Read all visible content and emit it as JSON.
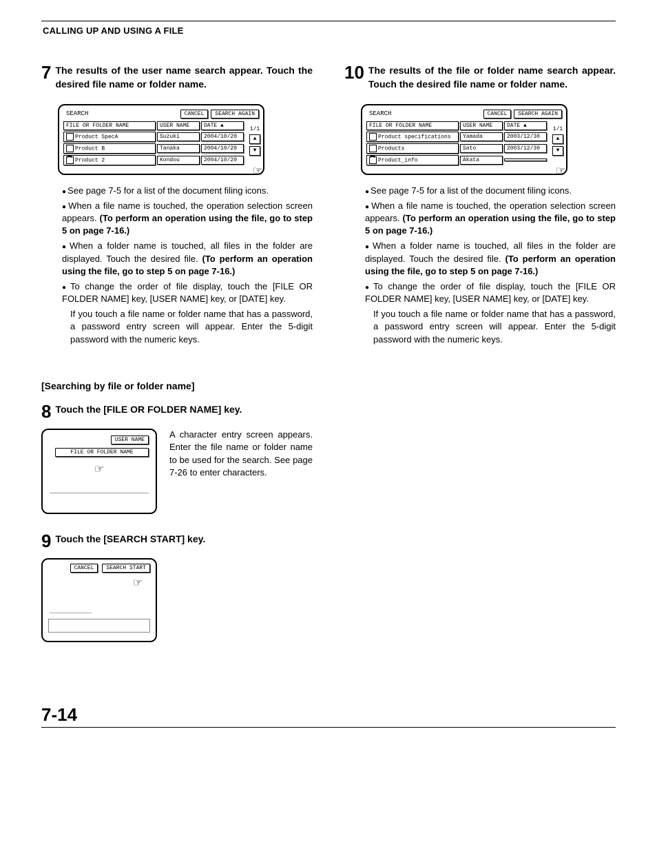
{
  "header": "CALLING UP AND USING A FILE",
  "page_number": "7-14",
  "left": {
    "step7": {
      "num": "7",
      "text": "The results of the user name search appear. Touch the desired file name or folder name.",
      "screen": {
        "title": "SEARCH",
        "cancel": "CANCEL",
        "search_again": "SEARCH AGAIN",
        "col_file": "FILE OR FOLDER NAME",
        "col_user": "USER NAME",
        "col_date": "DATE",
        "page_indicator": "1/1",
        "rows": [
          {
            "file": "Product SpecA",
            "user": "Suzuki",
            "date": "2004/10/20"
          },
          {
            "file": "Product B",
            "user": "Tanaka",
            "date": "2004/10/20"
          },
          {
            "file": "Product 2",
            "user": "Kondou",
            "date": "2004/10/20"
          }
        ]
      },
      "bullets": {
        "b1": "See page 7-5 for a list of the document filing icons.",
        "b2a": "When a file name is touched, the operation selection screen appears. ",
        "b2b": "(To perform an operation using the file, go to step 5 on page 7-16.)",
        "b3a": "When a folder name is touched, all files in the folder are displayed. Touch the desired file. ",
        "b3b": "(To perform an operation using the file, go to step 5 on page 7-16.)",
        "b4": "To change the order of file display, touch the [FILE OR FOLDER NAME] key, [USER NAME] key, or [DATE] key.",
        "b4c": "If you touch a file name or folder name that has a password, a password entry screen will appear. Enter the 5-digit password with the numeric keys."
      }
    },
    "subheading": "[Searching by file or folder name]",
    "step8": {
      "num": "8",
      "text": "Touch the [FILE OR FOLDER NAME] key.",
      "screen": {
        "user_name": "USER NAME",
        "file_folder": "FILE OR FOLDER NAME"
      },
      "desc": "A character entry screen appears. Enter the file name or folder name to be used for the search. See page 7-26 to enter characters."
    },
    "step9": {
      "num": "9",
      "text": "Touch the [SEARCH START] key.",
      "screen": {
        "cancel": "CANCEL",
        "search_start": "SEARCH START"
      }
    }
  },
  "right": {
    "step10": {
      "num": "10",
      "text": "The results of the file or folder name search appear. Touch the desired file name or folder name.",
      "screen": {
        "title": "SEARCH",
        "cancel": "CANCEL",
        "search_again": "SEARCH AGAIN",
        "col_file": "FILE OR FOLDER NAME",
        "col_user": "USER NAME",
        "col_date": "DATE",
        "page_indicator": "1/1",
        "rows": [
          {
            "file": "Product specifications",
            "user": "Yamada",
            "date": "2003/12/30"
          },
          {
            "file": "Products",
            "user": "Sato",
            "date": "2003/12/30"
          },
          {
            "file": "Product_info",
            "user": "Akata",
            "date": ""
          }
        ]
      },
      "bullets": {
        "b1": "See page 7-5 for a list of the document filing icons.",
        "b2a": "When a file name is touched, the operation selection screen appears. ",
        "b2b": "(To perform an operation using the file, go to step 5 on page 7-16.)",
        "b3a": "When a folder name is touched, all files in the folder are displayed. Touch the desired file. ",
        "b3b": "(To perform an operation using the file, go to step 5 on page 7-16.)",
        "b4": "To change the order of file display, touch the [FILE OR FOLDER NAME] key, [USER NAME] key, or [DATE] key.",
        "b4c": "If you touch a file name or folder name that has a password, a password entry screen will appear. Enter the 5-digit password with the numeric keys."
      }
    }
  }
}
